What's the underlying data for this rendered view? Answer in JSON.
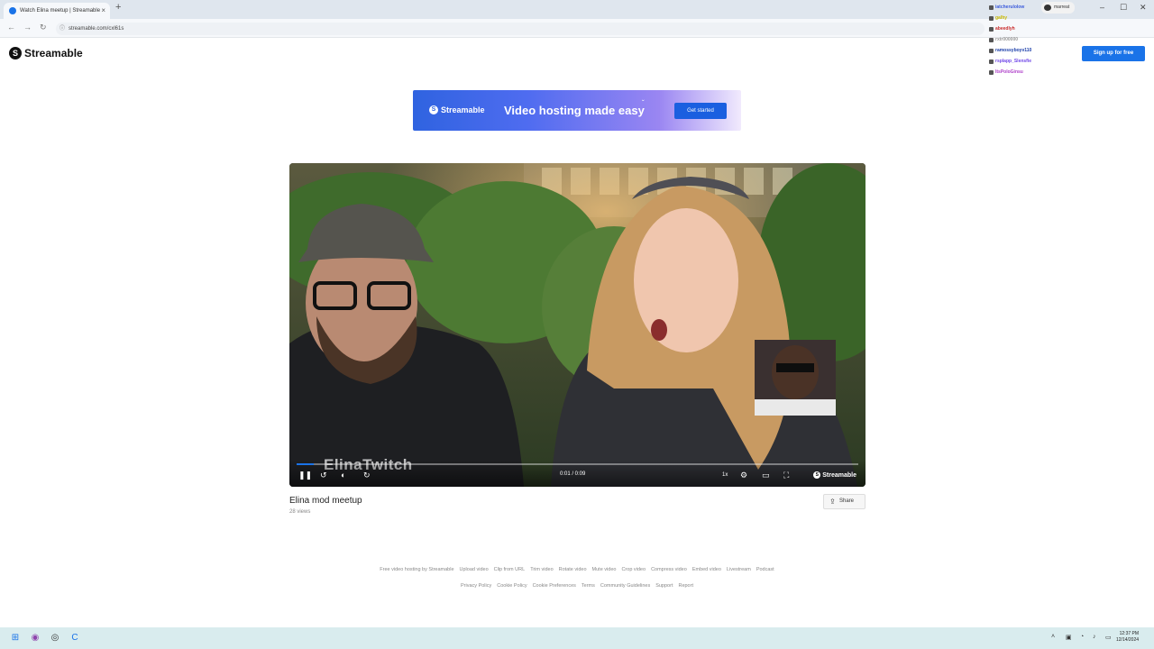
{
  "browser": {
    "tab_title": "Watch Elina meetup | Streamable",
    "url": "streamable.com/cxl61s",
    "new_tab": "+",
    "tab_close": "×"
  },
  "chat": {
    "lines": [
      {
        "name": "iatcherulolow",
        "color": "#3b5bdb"
      },
      {
        "name": "galhy",
        "color": "#c9b800"
      },
      {
        "name": "abeedlyh",
        "color": "#c92a2a"
      },
      {
        "name": "rxtr000000",
        "color": "#999999"
      },
      {
        "name": "ramossyboyv110",
        "color": "#1c3faa"
      },
      {
        "name": "rsplapp_Slensfie",
        "color": "#7048e8"
      },
      {
        "name": "ItsPoloGinsu",
        "color": "#ae3ec9"
      }
    ],
    "pill_user": "marreat"
  },
  "header": {
    "logo": "Streamable",
    "signup": "Sign up for free"
  },
  "banner": {
    "logo": "Streamable",
    "tagline": "Video hosting made easy",
    "cta": "Get started"
  },
  "player": {
    "watermark": "ElinaTwitch",
    "time": "0:01 / 0:09",
    "speed": "1x",
    "brand": "Streamable",
    "progress": 0.03
  },
  "video": {
    "title": "Elina mod meetup",
    "views": "28 views",
    "share": "Share"
  },
  "footer": {
    "row1": [
      "Free video hosting by Streamable",
      "Upload video",
      "Clip from URL",
      "Trim video",
      "Rotate video",
      "Mute video",
      "Crop video",
      "Compress video",
      "Embed video",
      "Livestream",
      "Podcast"
    ],
    "row2": [
      "Privacy Policy",
      "Cookie Policy",
      "Cookie Preferences",
      "Terms",
      "Community Guidelines",
      "Support",
      "Report"
    ]
  },
  "taskbar": {
    "time": "12:37 PM",
    "date": "12/14/2024"
  }
}
